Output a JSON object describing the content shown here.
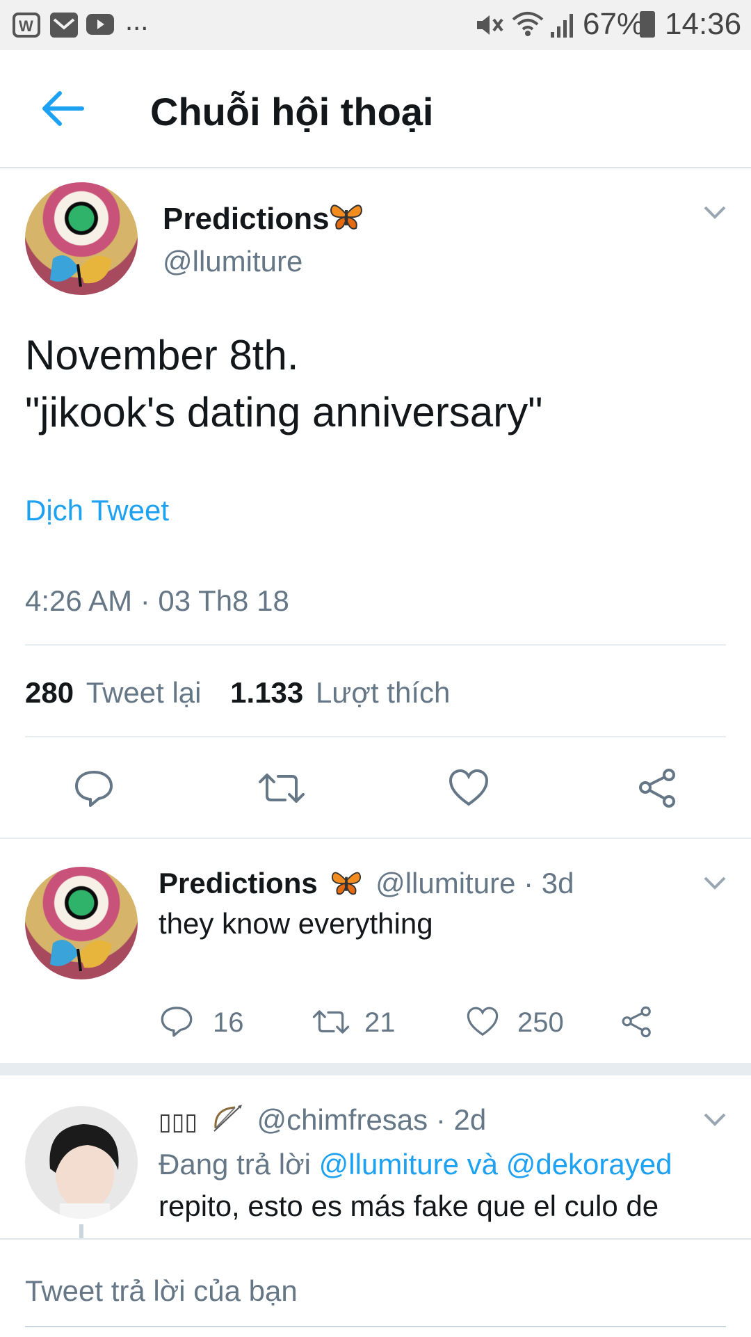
{
  "status_bar": {
    "battery": "67%",
    "time": "14:36",
    "more": "..."
  },
  "header": {
    "title": "Chuỗi hội thoại"
  },
  "main_tweet": {
    "name": "Predictions",
    "handle": "@llumiture",
    "text_line1": "November 8th.",
    "text_line2": "\"jikook's dating anniversary\"",
    "translate_label": "Dịch Tweet",
    "timestamp": "4:26 AM · 03 Th8 18",
    "retweet_count": "280",
    "retweet_label": "Tweet lại",
    "like_count": "1.133",
    "like_label": "Lượt thích"
  },
  "reply1": {
    "name": "Predictions",
    "handle": "@llumiture",
    "time": "· 3d",
    "text": "they know everything",
    "reply_count": "16",
    "retweet_count": "21",
    "like_count": "250"
  },
  "reply2": {
    "name_glyphs": "▯▯▯",
    "handle": "@chimfresas",
    "time": "· 2d",
    "replying_prefix": "Đang trả lời",
    "replying_to_1": "@llumiture",
    "replying_and": "và",
    "replying_to_2": "@dekorayed",
    "text": "repito, esto es más fake que el culo de"
  },
  "compose": {
    "placeholder": "Tweet trả lời của bạn"
  },
  "colors": {
    "accent": "#1da1f2",
    "secondary_text": "#657786",
    "divider": "#e6ecf0"
  }
}
